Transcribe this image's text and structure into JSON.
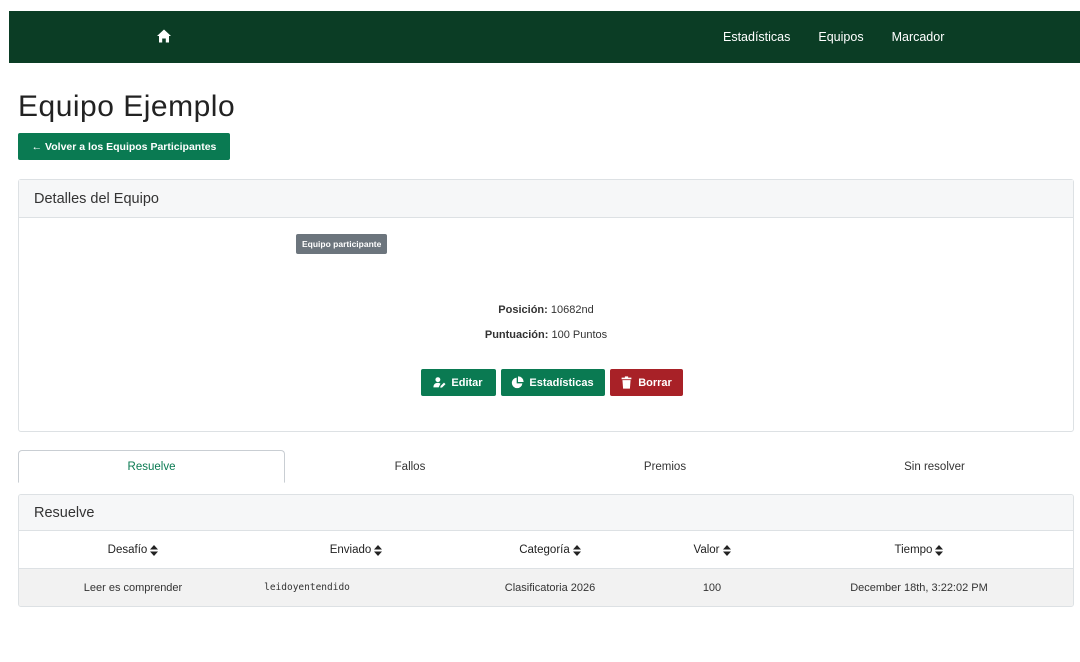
{
  "navbar": {
    "home_icon": "home-icon",
    "links": [
      "Estadísticas",
      "Equipos",
      "Marcador"
    ],
    "background": "#0b3d25"
  },
  "page": {
    "title": "Equipo Ejemplo",
    "back_label": "← Volver a los Equipos Participantes"
  },
  "details": {
    "header": "Detalles del Equipo",
    "badge": "Equipo participante",
    "position_label": "Posición:",
    "position_value": "10682nd",
    "score_label": "Puntuación:",
    "score_value": "100 Puntos",
    "buttons": {
      "edit": "Editar",
      "stats": "Estadísticas",
      "delete": "Borrar"
    }
  },
  "tabs": [
    "Resuelve",
    "Fallos",
    "Premios",
    "Sin resolver"
  ],
  "solves": {
    "header": "Resuelve",
    "columns": [
      "Desafío",
      "Enviado",
      "Categoría",
      "Valor",
      "Tiempo"
    ],
    "rows": [
      {
        "challenge": "Leer es comprender",
        "submitted": "leidoyentendido",
        "category": "Clasificatoria 2026",
        "value": "100",
        "time": "December 18th, 3:22:02 PM"
      }
    ]
  },
  "colors": {
    "primary": "#0a7a52",
    "danger": "#a82127",
    "secondary": "#6c757d"
  }
}
